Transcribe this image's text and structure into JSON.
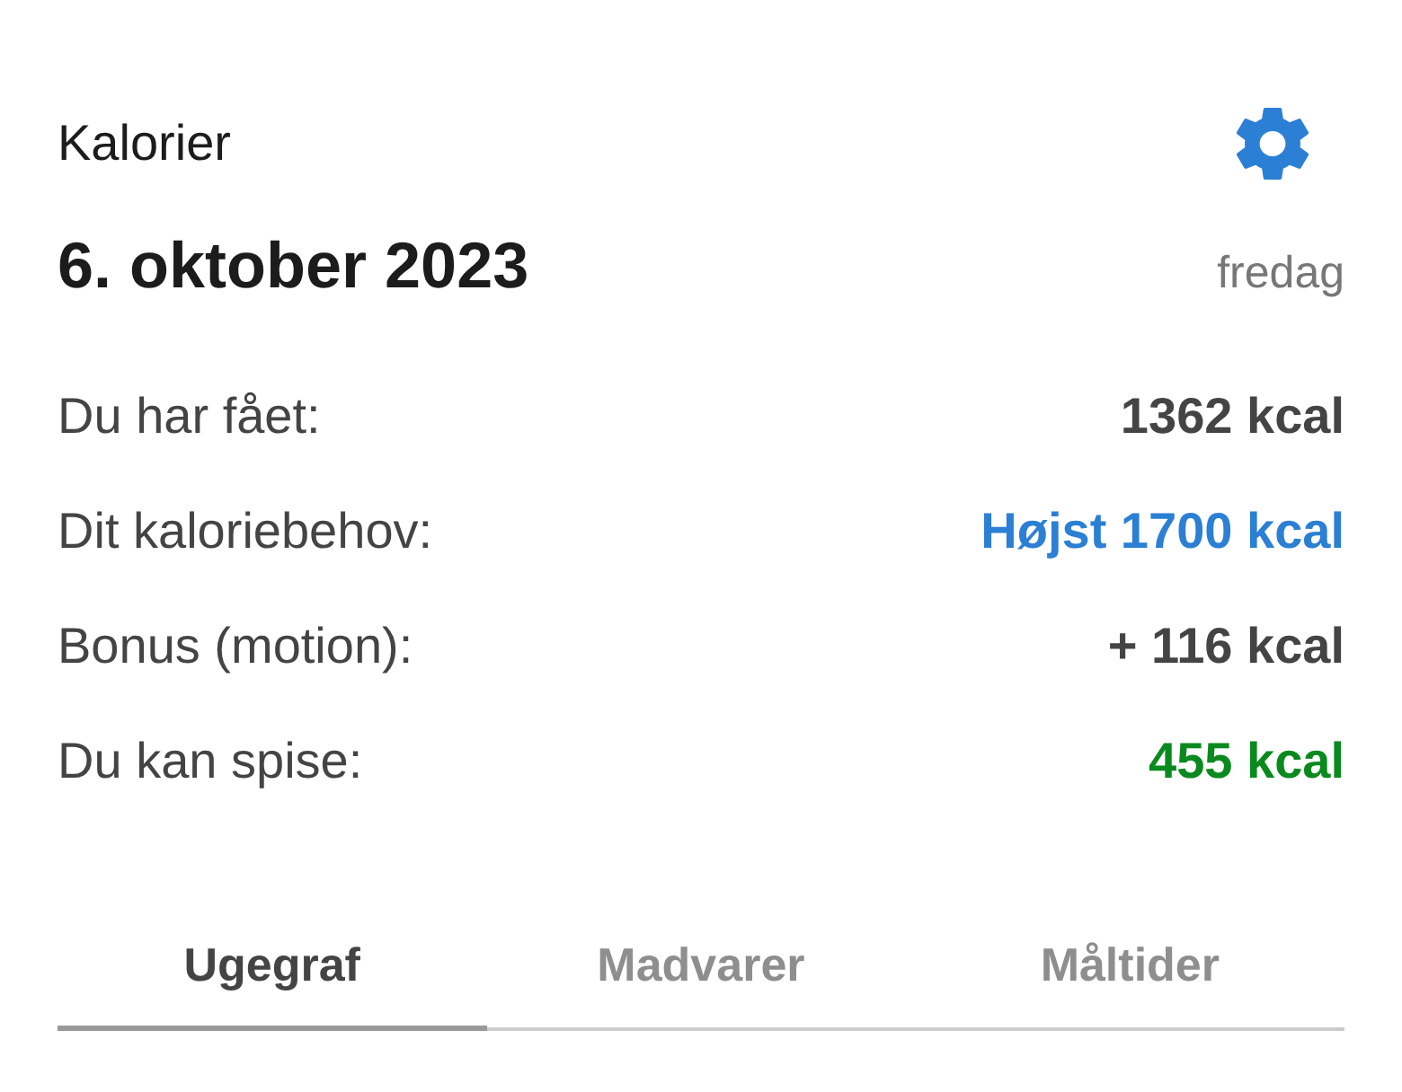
{
  "header": {
    "title": "Kalorier",
    "date": "6. oktober 2023",
    "weekday": "fredag"
  },
  "rows": [
    {
      "label": "Du har fået:",
      "value": "1362 kcal",
      "color": "#444444"
    },
    {
      "label": "Dit kaloriebehov:",
      "value": "Højst 1700 kcal",
      "color": "#2b7fd4"
    },
    {
      "label": "Bonus (motion):",
      "value": "+ 116 kcal",
      "color": "#444444"
    },
    {
      "label": "Du kan spise:",
      "value": "455 kcal",
      "color": "#0a8a1e"
    }
  ],
  "tabs": [
    {
      "label": "Ugegraf",
      "selected": true
    },
    {
      "label": "Madvarer",
      "selected": false
    },
    {
      "label": "Måltider",
      "selected": false
    }
  ]
}
